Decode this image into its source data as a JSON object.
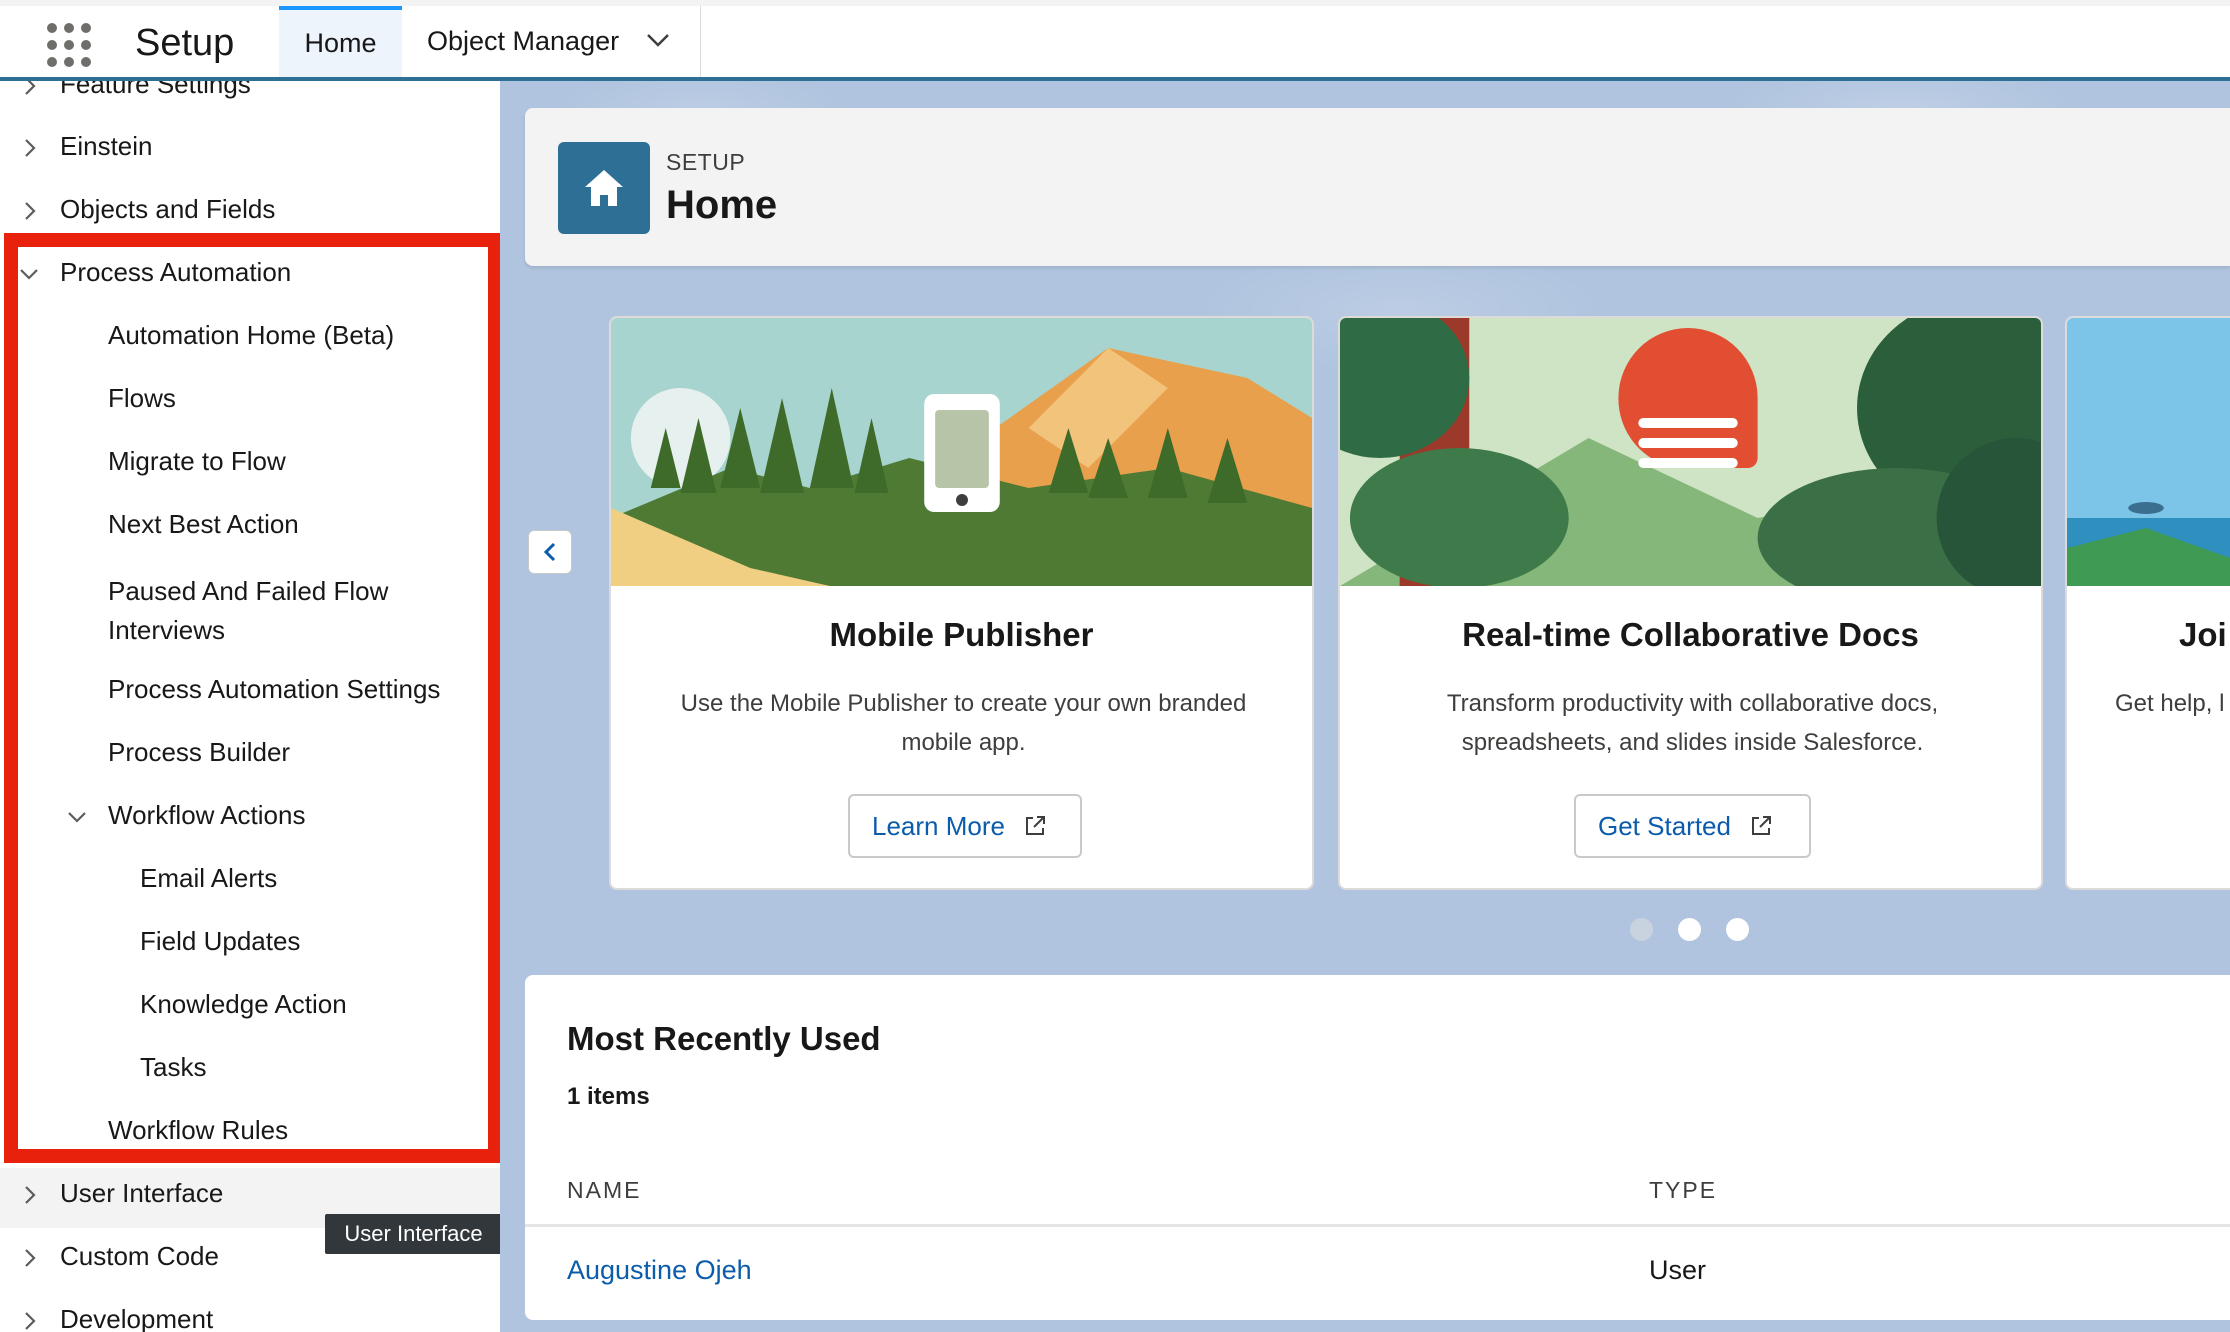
{
  "app": {
    "name": "Setup"
  },
  "tabs": [
    {
      "label": "Home"
    },
    {
      "label": "Object Manager"
    }
  ],
  "sidebar": {
    "items": [
      {
        "label": "Feature Settings"
      },
      {
        "label": "Einstein"
      },
      {
        "label": "Objects and Fields"
      },
      {
        "label": "Process Automation"
      },
      {
        "label": "Automation Home (Beta)"
      },
      {
        "label": "Flows"
      },
      {
        "label": "Migrate to Flow"
      },
      {
        "label": "Next Best Action"
      },
      {
        "label": "Paused And Failed Flow Interviews"
      },
      {
        "label": "Process Automation Settings"
      },
      {
        "label": "Process Builder"
      },
      {
        "label": "Workflow Actions"
      },
      {
        "label": "Email Alerts"
      },
      {
        "label": "Field Updates"
      },
      {
        "label": "Knowledge Action"
      },
      {
        "label": "Tasks"
      },
      {
        "label": "Workflow Rules"
      },
      {
        "label": "User Interface"
      },
      {
        "label": "Custom Code"
      },
      {
        "label": "Development"
      }
    ],
    "tooltip": "User Interface"
  },
  "header": {
    "eyebrow": "SETUP",
    "title": "Home"
  },
  "cards": [
    {
      "title": "Mobile Publisher",
      "description": "Use the Mobile Publisher to create your own branded mobile app.",
      "button": "Learn More"
    },
    {
      "title": "Real-time Collaborative Docs",
      "description": "Transform productivity with collaborative docs, spreadsheets, and slides inside Salesforce.",
      "button": "Get Started"
    },
    {
      "title": "Joi",
      "description": "Get help, l"
    }
  ],
  "mru": {
    "title": "Most Recently Used",
    "count": "1 items",
    "columns": [
      "NAME",
      "TYPE"
    ],
    "rows": [
      {
        "name": "Augustine Ojeh",
        "type": "User"
      }
    ]
  },
  "colors": {
    "brand": "#2e6f96",
    "accent": "#1b96ff",
    "highlight": "#e8210c",
    "link": "#0b5cab"
  }
}
